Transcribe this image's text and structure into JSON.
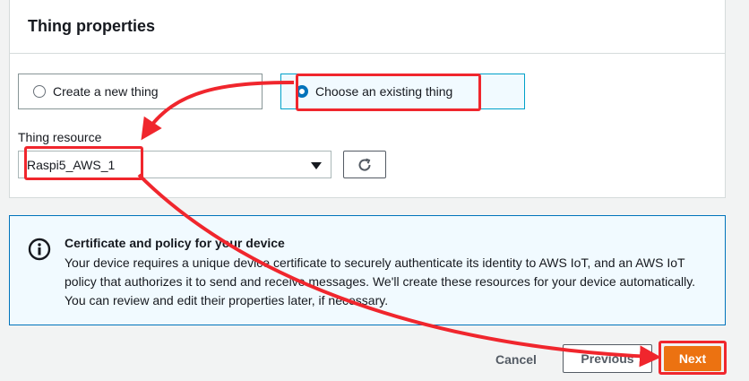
{
  "panel": {
    "title": "Thing properties",
    "options": [
      {
        "label": "Create a new thing",
        "selected": false
      },
      {
        "label": "Choose an existing thing",
        "selected": true
      }
    ],
    "thing_resource_label": "Thing resource",
    "thing_resource_value": "Raspi5_AWS_1"
  },
  "info": {
    "title": "Certificate and policy for your device",
    "text": "Your device requires a unique device certificate to securely authenticate its identity to AWS IoT, and an AWS IoT policy that authorizes it to send and receive messages. We'll create these resources for your device automatically. You can review and edit their properties later, if necessary."
  },
  "footer": {
    "cancel_label": "Cancel",
    "previous_label": "Previous",
    "next_label": "Next"
  },
  "colors": {
    "primary_button": "#ec7211",
    "selection": "#0073bb",
    "annotation": "#f0262d"
  },
  "icons": {
    "info": "info-circle-icon",
    "refresh": "refresh-icon",
    "dropdown": "caret-down-icon"
  }
}
